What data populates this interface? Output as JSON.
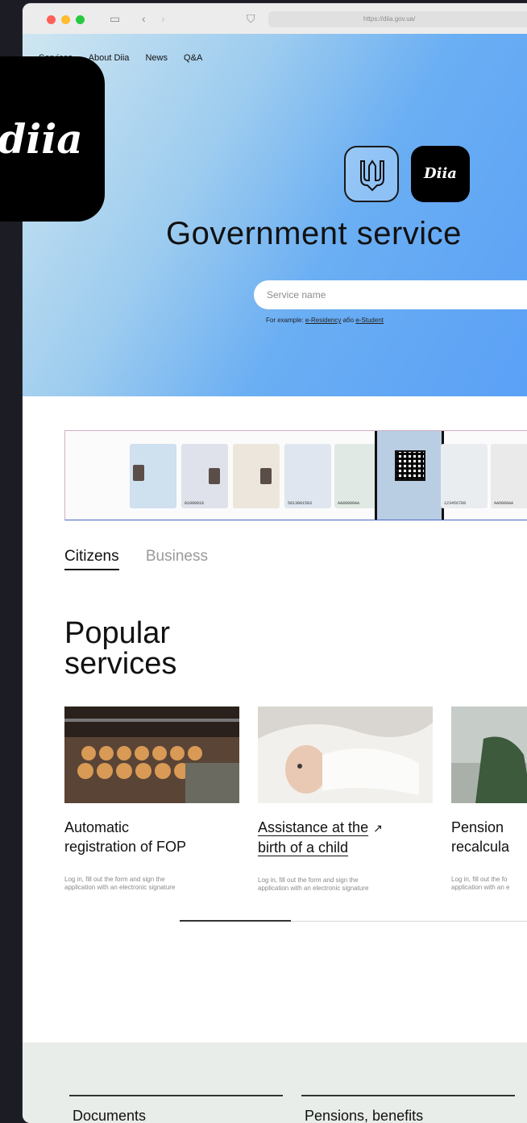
{
  "browser": {
    "url": "https://diia.gov.ua/"
  },
  "nav": {
    "items": [
      "Services",
      "About Diia",
      "News",
      "Q&A"
    ]
  },
  "hero": {
    "logo_text": "Diia",
    "title": "Government service",
    "search_placeholder": "Service name",
    "examples_prefix": "For example: ",
    "example_1": "e-Residency",
    "examples_middle": " або ",
    "example_2": "e-Student"
  },
  "big_logo_text": "diia",
  "document_cards": {
    "numbers": [
      "",
      "01000018",
      "5013001583",
      "AA00000AA",
      "",
      "123456789",
      "AAO000AA"
    ]
  },
  "tabs": {
    "citizens": "Citizens",
    "business": "Business"
  },
  "popular": {
    "title_line1": "Popular",
    "title_line2": "services",
    "services": [
      {
        "title_line1": "Automatic",
        "title_line2": "registration of FOP",
        "desc_line1": "Log in, fill out the form and sign the",
        "desc_line2": "application with an electronic signature",
        "image_icon": "baking-tray-image"
      },
      {
        "title_line1": "Assistance at the",
        "title_line2": "birth of a child",
        "desc_line1": "Log in, fill out the form and sign the",
        "desc_line2": "application with an electronic signature",
        "image_icon": "baby-image"
      },
      {
        "title_line1": "Pension",
        "title_line2": "recalcula",
        "desc_line1": "Log in, fill out the fo",
        "desc_line2": "application with an e",
        "image_icon": "beach-person-image"
      }
    ],
    "carousel_progress": 0.31
  },
  "footer": {
    "columns": [
      "Documents",
      "Pensions, benefits"
    ]
  },
  "colors": {
    "hero_gradient_start": "#cfe6f0",
    "hero_gradient_end": "#5aa0f6",
    "logo_bg": "#000000",
    "footer_bg": "#e8ede9"
  }
}
